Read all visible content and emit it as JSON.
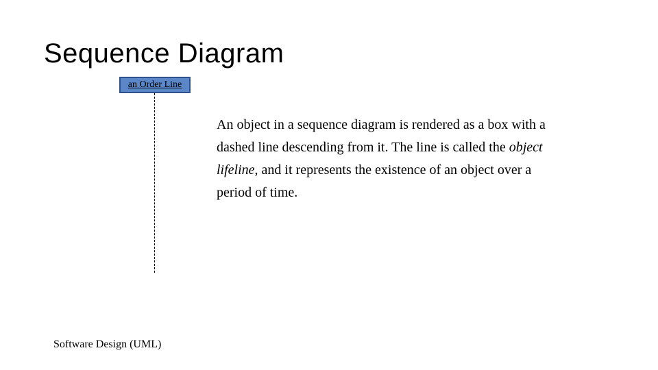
{
  "title": "Sequence Diagram",
  "object_label": "an Order Line",
  "body": {
    "p1": "An object in a sequence diagram is rendered as a box with a dashed line descending from it. The line is called the ",
    "italic": "object lifeline",
    "p2": ", and it represents the existence of an object over a period of time."
  },
  "footer": "Software Design (UML)"
}
